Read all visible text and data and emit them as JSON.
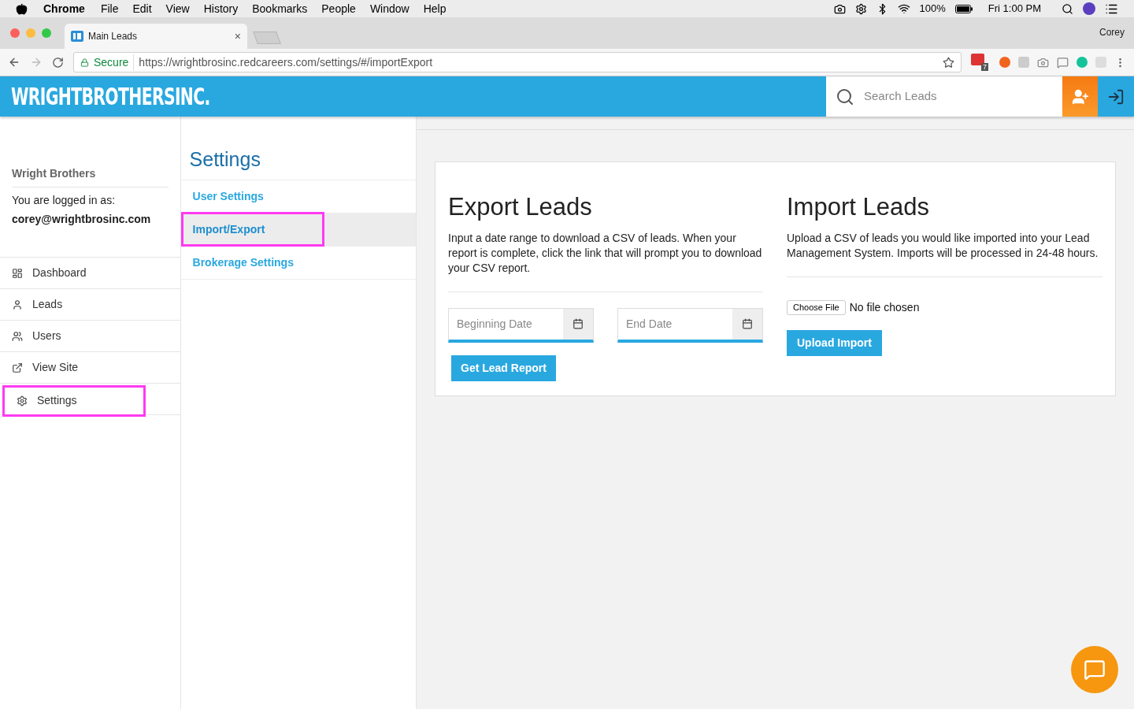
{
  "menu_bar": {
    "app": "Chrome",
    "items": [
      "File",
      "Edit",
      "View",
      "History",
      "Bookmarks",
      "People",
      "Window",
      "Help"
    ],
    "battery": "100%",
    "clock": "Fri 1:00 PM"
  },
  "browser": {
    "tab": {
      "title": "Main Leads",
      "close": "×"
    },
    "profile": "Corey",
    "secure": "Secure",
    "url": "https://wrightbrosinc.redcareers.com/settings/#/importExport",
    "extension_badge": "7"
  },
  "header": {
    "logo": "WRIGHTBROTHERSINC.",
    "search": {
      "placeholder": "Search Leads"
    }
  },
  "account": {
    "company": "Wright Brothers",
    "logged_in_label": "You are logged in as:",
    "email": "corey@wrightbrosinc.com"
  },
  "sidebar": {
    "items": [
      {
        "label": "Dashboard",
        "kind": "dashboard",
        "highlighted": false
      },
      {
        "label": "Leads",
        "kind": "person",
        "highlighted": false
      },
      {
        "label": "Users",
        "kind": "people",
        "highlighted": false
      },
      {
        "label": "View Site",
        "kind": "external",
        "highlighted": false
      },
      {
        "label": "Settings",
        "kind": "gear",
        "highlighted": true
      }
    ]
  },
  "settings_nav": {
    "title": "Settings",
    "items": [
      {
        "label": "User Settings",
        "selected": false,
        "highlighted": false
      },
      {
        "label": "Import/Export",
        "selected": true,
        "highlighted": true
      },
      {
        "label": "Brokerage Settings",
        "selected": false,
        "highlighted": false
      }
    ]
  },
  "export": {
    "title": "Export Leads",
    "description": "Input a date range to download a CSV of leads. When your report is complete, click the link that will prompt you to download your CSV report.",
    "fields": [
      {
        "placeholder": "Beginning Date"
      },
      {
        "placeholder": "End Date"
      }
    ],
    "button": "Get Lead Report"
  },
  "import": {
    "title": "Import Leads",
    "description": "Upload a CSV of leads you would like imported into your Lead Management System. Imports will be processed in 24-48 hours.",
    "choose_file": "Choose File",
    "file_status": "No file chosen",
    "button": "Upload Import"
  }
}
